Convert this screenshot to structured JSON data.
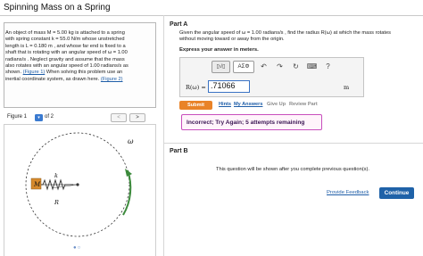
{
  "header": {
    "title": "Spinning Mass on a Spring"
  },
  "problem": {
    "lines": [
      "An object of mass M = 5.00 kg is attached to a spring",
      "with spring constant k = 55.0 N/m whose unstretched",
      "length is L = 0.180 m , and whose far end is fixed to a",
      "shaft that is rotating with an angular speed of ω = 1.00",
      "radians/s . Neglect gravity and assume that the mass",
      "also rotates with an angular speed of 1.00 radians/s as"
    ],
    "line7_prefix": "shown. ",
    "line7_link": "(Figure 1)",
    "line7_suffix": " When solving this problem use an",
    "line8_prefix": "inertial coordinate system, as drawn here. ",
    "line8_link": "(Figure 2)"
  },
  "figure": {
    "label": "Figure 1",
    "selector_icon": "chevron-down-icon",
    "of_text": "of 2",
    "prev": "<",
    "next": ">",
    "omega_label": "ω",
    "spring_label": "k",
    "mass_label": "M",
    "radius_label": "R",
    "dots": "●○",
    "colors": {
      "arrow": "#3c8a3c",
      "mass": "#d78a2c"
    }
  },
  "part_a": {
    "label": "Part A",
    "question_line1": "Given the angular speed of ω = 1.00 radians/s , find the radius R(ω) at which the mass rotates",
    "question_line2": "without moving toward or away from the origin.",
    "instruction": "Express your answer in meters.",
    "toolbar": {
      "math": "▯√▯",
      "symbols": "ΑΣΦ",
      "undo": "↶",
      "redo": "↷",
      "refresh": "↻",
      "keyboard": "⌨",
      "help": "?"
    },
    "answer_label": "R(ω) =",
    "answer_value": ".71066",
    "answer_unit": "m",
    "submit": "Submit",
    "hints": "Hints",
    "my_answers": "My Answers",
    "give_up": "Give Up",
    "review_part": "Review Part",
    "feedback": "Incorrect; Try Again; 5 attempts remaining"
  },
  "part_b": {
    "label": "Part B",
    "note": "This question will be shown after you complete previous question(s)."
  },
  "footer": {
    "provide_feedback": "Provide Feedback",
    "continue": "Continue"
  }
}
